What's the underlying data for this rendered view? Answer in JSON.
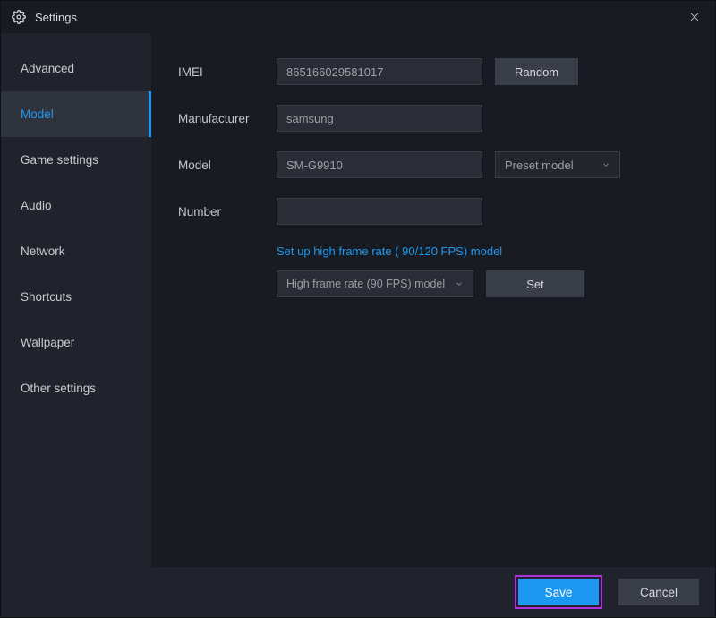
{
  "window": {
    "title": "Settings"
  },
  "sidebar": {
    "items": [
      {
        "label": "Advanced"
      },
      {
        "label": "Model"
      },
      {
        "label": "Game settings"
      },
      {
        "label": "Audio"
      },
      {
        "label": "Network"
      },
      {
        "label": "Shortcuts"
      },
      {
        "label": "Wallpaper"
      },
      {
        "label": "Other settings"
      }
    ],
    "active_index": 1
  },
  "fields": {
    "imei": {
      "label": "IMEI",
      "value": "865166029581017"
    },
    "manufacturer": {
      "label": "Manufacturer",
      "value": "samsung"
    },
    "model": {
      "label": "Model",
      "value": "SM-G9910"
    },
    "number": {
      "label": "Number",
      "value": ""
    },
    "preset_model": {
      "label": "Preset model"
    },
    "random_btn": "Random",
    "hfr_link": "Set up high frame rate ( 90/120 FPS) model",
    "hfr_select": "High frame rate (90 FPS) model",
    "set_btn": "Set"
  },
  "footer": {
    "save": "Save",
    "cancel": "Cancel"
  }
}
